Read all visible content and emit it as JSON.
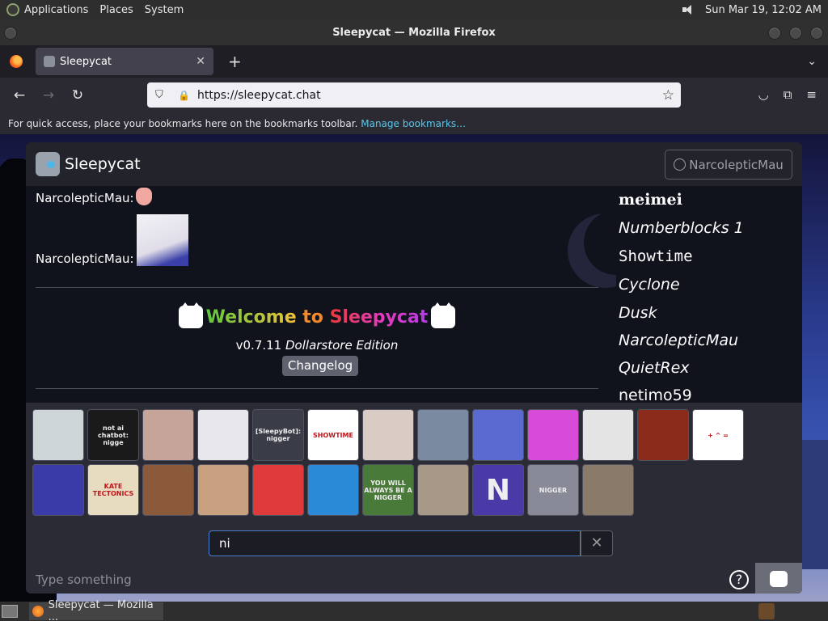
{
  "top_panel": {
    "menus": [
      "Applications",
      "Places",
      "System"
    ],
    "clock": "Sun Mar 19, 12:02 AM"
  },
  "window": {
    "title": "Sleepycat — Mozilla Firefox"
  },
  "browser": {
    "tab_title": "Sleepycat",
    "url": "https://sleepycat.chat",
    "bookmarks_hint": "For quick access, place your bookmarks here on the bookmarks toolbar.",
    "manage_bookmarks": "Manage bookmarks…"
  },
  "app": {
    "brand": "Sleepycat",
    "user_button": "NarcolepticMau",
    "messages": [
      {
        "author": "NarcolepticMau:"
      },
      {
        "author": "NarcolepticMau:"
      }
    ],
    "welcome": {
      "prefix": "Welcome",
      "middle": " to ",
      "name": "Sleepycat",
      "version": "v0.7.11",
      "edition": "Dollarstore Edition",
      "changelog": "Changelog"
    },
    "users": [
      {
        "name": "meimei",
        "color": "#f0a8c8"
      },
      {
        "name": "Numberblocks 1",
        "color": "#e01818"
      },
      {
        "name": "Showtime",
        "color": "#5fe05f"
      },
      {
        "name": "Cyclone",
        "color": "#3fdc3f"
      },
      {
        "name": "Dusk",
        "color": "#2f3fc8"
      },
      {
        "name": "NarcolepticMau",
        "color": "#ffffff"
      },
      {
        "name": "QuietRex",
        "color": "#ffffff"
      },
      {
        "name": "netimo59",
        "color": "#ffffff"
      }
    ],
    "picker": {
      "tiles": [
        {
          "label": "",
          "bg": "#cfd6d8"
        },
        {
          "label": "not ai chatbot: nigge",
          "bg": "#1a1a1a"
        },
        {
          "label": "",
          "bg": "#c7a49a"
        },
        {
          "label": "",
          "bg": "#e8e8ec"
        },
        {
          "label": "[SleepyBot]: nigger",
          "bg": "#3a3c48"
        },
        {
          "label": "SHOWTIME",
          "bg": "#ffffff"
        },
        {
          "label": "",
          "bg": "#d8ccc4"
        },
        {
          "label": "",
          "bg": "#7a8aa0"
        },
        {
          "label": "",
          "bg": "#5a6ad0"
        },
        {
          "label": "",
          "bg": "#d84ad8"
        },
        {
          "label": "",
          "bg": "#e4e4e4"
        },
        {
          "label": "",
          "bg": "#8a2a1a"
        },
        {
          "label": "+ ^ =",
          "bg": "#ffffff"
        },
        {
          "label": "",
          "bg": "#3a3aa8"
        },
        {
          "label": "KATE TECTONICS",
          "bg": "#e8dcc0"
        },
        {
          "label": "",
          "bg": "#8a5a3a"
        },
        {
          "label": "",
          "bg": "#c8a080"
        },
        {
          "label": "",
          "bg": "#e03a3a"
        },
        {
          "label": "",
          "bg": "#2a8ad8"
        },
        {
          "label": "YOU WILL ALWAYS BE A NIGGER",
          "bg": "#4a7a3a"
        },
        {
          "label": "",
          "bg": "#a89888"
        },
        {
          "label": "N",
          "bg": "#4a3aa8"
        },
        {
          "label": "NIGGER",
          "bg": "#888a98"
        },
        {
          "label": "",
          "bg": "#8a7a6a"
        }
      ],
      "search_value": "ni"
    },
    "compose_placeholder": "Type something",
    "help_label": "?"
  },
  "taskbar": {
    "item": "Sleepycat — Mozilla ..."
  }
}
